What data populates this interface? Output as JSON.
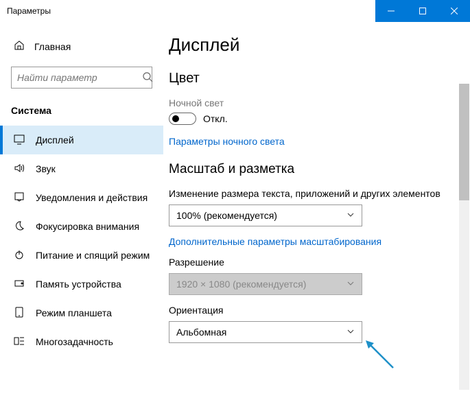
{
  "window": {
    "title": "Параметры"
  },
  "sidebar": {
    "home": "Главная",
    "search_placeholder": "Найти параметр",
    "category": "Система",
    "items": [
      {
        "label": "Дисплей"
      },
      {
        "label": "Звук"
      },
      {
        "label": "Уведомления и действия"
      },
      {
        "label": "Фокусировка внимания"
      },
      {
        "label": "Питание и спящий режим"
      },
      {
        "label": "Память устройства"
      },
      {
        "label": "Режим планшета"
      },
      {
        "label": "Многозадачность"
      }
    ]
  },
  "main": {
    "title": "Дисплей",
    "color_heading": "Цвет",
    "nightlight_label": "Ночной свет",
    "nightlight_state": "Откл.",
    "nightlight_link": "Параметры ночного света",
    "scale_heading": "Масштаб и разметка",
    "scale_label": "Изменение размера текста, приложений и других элементов",
    "scale_value": "100% (рекомендуется)",
    "scale_link": "Дополнительные параметры масштабирования",
    "resolution_label": "Разрешение",
    "resolution_value": "1920 × 1080 (рекомендуется)",
    "orientation_label": "Ориентация",
    "orientation_value": "Альбомная"
  }
}
